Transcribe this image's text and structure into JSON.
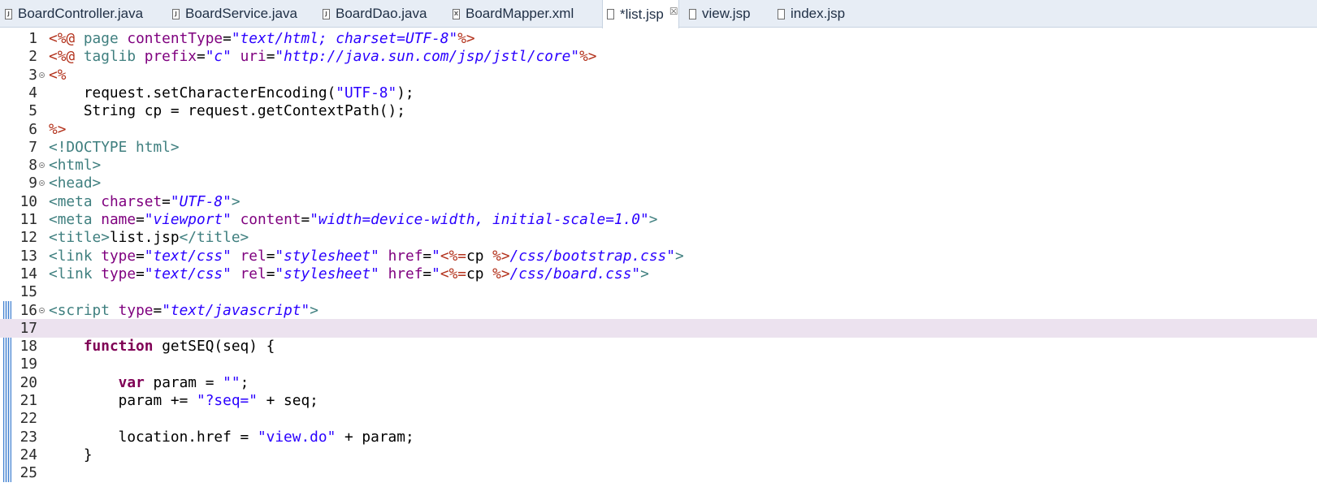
{
  "tabs": [
    {
      "label": "BoardController.java",
      "icon": "java-file-icon",
      "glyph": "J",
      "active": false
    },
    {
      "label": "BoardService.java",
      "icon": "java-file-icon",
      "glyph": "J",
      "active": false
    },
    {
      "label": "BoardDao.java",
      "icon": "java-file-icon",
      "glyph": "J",
      "active": false
    },
    {
      "label": "BoardMapper.xml",
      "icon": "xml-file-icon",
      "glyph": "X",
      "active": false
    },
    {
      "label": "*list.jsp",
      "icon": "jsp-file-icon",
      "glyph": "",
      "active": true,
      "close": "☒"
    },
    {
      "label": "view.jsp",
      "icon": "jsp-file-icon",
      "glyph": "",
      "active": false
    },
    {
      "label": "index.jsp",
      "icon": "jsp-file-icon",
      "glyph": "",
      "active": false
    }
  ],
  "editor": {
    "current_line": 17,
    "lines": [
      {
        "n": "1",
        "fold": false,
        "changed": false,
        "tokens": [
          [
            "jsp",
            "<%@ "
          ],
          [
            "dir",
            "page "
          ],
          [
            "attr",
            "contentType"
          ],
          [
            "plain",
            "="
          ],
          [
            "aval",
            "\"text/html; charset=UTF-8\""
          ],
          [
            "jsp",
            "%>"
          ]
        ]
      },
      {
        "n": "2",
        "fold": false,
        "changed": false,
        "tokens": [
          [
            "jsp",
            "<%@ "
          ],
          [
            "dir",
            "taglib "
          ],
          [
            "attr",
            "prefix"
          ],
          [
            "plain",
            "="
          ],
          [
            "aval",
            "\"c\""
          ],
          [
            "plain",
            " "
          ],
          [
            "attr",
            "uri"
          ],
          [
            "plain",
            "="
          ],
          [
            "aval",
            "\"http://java.sun.com/jsp/jstl/core\""
          ],
          [
            "jsp",
            "%>"
          ]
        ]
      },
      {
        "n": "3",
        "fold": true,
        "changed": false,
        "tokens": [
          [
            "jsp",
            "<%"
          ]
        ]
      },
      {
        "n": "4",
        "fold": false,
        "changed": false,
        "tokens": [
          [
            "plain",
            "    request.setCharacterEncoding("
          ],
          [
            "str",
            "\"UTF-8\""
          ],
          [
            "plain",
            ");"
          ]
        ]
      },
      {
        "n": "5",
        "fold": false,
        "changed": false,
        "tokens": [
          [
            "plain",
            "    String cp = request.getContextPath();"
          ]
        ]
      },
      {
        "n": "6",
        "fold": false,
        "changed": false,
        "tokens": [
          [
            "jsp",
            "%>"
          ]
        ]
      },
      {
        "n": "7",
        "fold": false,
        "changed": false,
        "tokens": [
          [
            "tag",
            "<!DOCTYPE html>"
          ]
        ]
      },
      {
        "n": "8",
        "fold": true,
        "changed": false,
        "tokens": [
          [
            "tag",
            "<html>"
          ]
        ]
      },
      {
        "n": "9",
        "fold": true,
        "changed": false,
        "tokens": [
          [
            "tag",
            "<head>"
          ]
        ]
      },
      {
        "n": "10",
        "fold": false,
        "changed": false,
        "tokens": [
          [
            "tag",
            "<meta "
          ],
          [
            "attr",
            "charset"
          ],
          [
            "plain",
            "="
          ],
          [
            "aval",
            "\"UTF-8\""
          ],
          [
            "tag",
            ">"
          ]
        ]
      },
      {
        "n": "11",
        "fold": false,
        "changed": false,
        "tokens": [
          [
            "tag",
            "<meta "
          ],
          [
            "attr",
            "name"
          ],
          [
            "plain",
            "="
          ],
          [
            "aval",
            "\"viewport\""
          ],
          [
            "plain",
            " "
          ],
          [
            "attr",
            "content"
          ],
          [
            "plain",
            "="
          ],
          [
            "aval",
            "\"width=device-width, initial-scale=1.0\""
          ],
          [
            "tag",
            ">"
          ]
        ]
      },
      {
        "n": "12",
        "fold": false,
        "changed": false,
        "tokens": [
          [
            "tag",
            "<title>"
          ],
          [
            "plain",
            "list.jsp"
          ],
          [
            "tag",
            "</title>"
          ]
        ]
      },
      {
        "n": "13",
        "fold": false,
        "changed": false,
        "tokens": [
          [
            "tag",
            "<link "
          ],
          [
            "attr",
            "type"
          ],
          [
            "plain",
            "="
          ],
          [
            "aval",
            "\"text/css\""
          ],
          [
            "plain",
            " "
          ],
          [
            "attr",
            "rel"
          ],
          [
            "plain",
            "="
          ],
          [
            "aval",
            "\"stylesheet\""
          ],
          [
            "plain",
            " "
          ],
          [
            "attr",
            "href"
          ],
          [
            "plain",
            "="
          ],
          [
            "aval",
            "\""
          ],
          [
            "jsp",
            "<%="
          ],
          [
            "plain",
            "cp "
          ],
          [
            "jsp",
            "%>"
          ],
          [
            "aval",
            "/css/bootstrap.css\""
          ],
          [
            "tag",
            ">"
          ]
        ]
      },
      {
        "n": "14",
        "fold": false,
        "changed": false,
        "tokens": [
          [
            "tag",
            "<link "
          ],
          [
            "attr",
            "type"
          ],
          [
            "plain",
            "="
          ],
          [
            "aval",
            "\"text/css\""
          ],
          [
            "plain",
            " "
          ],
          [
            "attr",
            "rel"
          ],
          [
            "plain",
            "="
          ],
          [
            "aval",
            "\"stylesheet\""
          ],
          [
            "plain",
            " "
          ],
          [
            "attr",
            "href"
          ],
          [
            "plain",
            "="
          ],
          [
            "aval",
            "\""
          ],
          [
            "jsp",
            "<%="
          ],
          [
            "plain",
            "cp "
          ],
          [
            "jsp",
            "%>"
          ],
          [
            "aval",
            "/css/board.css\""
          ],
          [
            "tag",
            ">"
          ]
        ]
      },
      {
        "n": "15",
        "fold": false,
        "changed": false,
        "tokens": []
      },
      {
        "n": "16",
        "fold": true,
        "changed": true,
        "tokens": [
          [
            "tag",
            "<script "
          ],
          [
            "attr",
            "type"
          ],
          [
            "plain",
            "="
          ],
          [
            "aval",
            "\"text/javascript\""
          ],
          [
            "tag",
            ">"
          ]
        ]
      },
      {
        "n": "17",
        "fold": false,
        "changed": true,
        "tokens": []
      },
      {
        "n": "18",
        "fold": false,
        "changed": true,
        "tokens": [
          [
            "plain",
            "    "
          ],
          [
            "kw",
            "function"
          ],
          [
            "plain",
            " getSEQ(seq) {"
          ]
        ]
      },
      {
        "n": "19",
        "fold": false,
        "changed": true,
        "tokens": []
      },
      {
        "n": "20",
        "fold": false,
        "changed": true,
        "tokens": [
          [
            "plain",
            "        "
          ],
          [
            "kw",
            "var"
          ],
          [
            "plain",
            " param = "
          ],
          [
            "str",
            "\"\""
          ],
          [
            "plain",
            ";"
          ]
        ]
      },
      {
        "n": "21",
        "fold": false,
        "changed": true,
        "tokens": [
          [
            "plain",
            "        param += "
          ],
          [
            "str",
            "\"?seq=\""
          ],
          [
            "plain",
            " + seq;"
          ]
        ]
      },
      {
        "n": "22",
        "fold": false,
        "changed": true,
        "tokens": []
      },
      {
        "n": "23",
        "fold": false,
        "changed": true,
        "tokens": [
          [
            "plain",
            "        location.href = "
          ],
          [
            "str",
            "\"view.do\""
          ],
          [
            "plain",
            " + param;"
          ]
        ]
      },
      {
        "n": "24",
        "fold": false,
        "changed": true,
        "tokens": [
          [
            "plain",
            "    }"
          ]
        ]
      },
      {
        "n": "25",
        "fold": false,
        "changed": true,
        "tokens": []
      }
    ]
  }
}
